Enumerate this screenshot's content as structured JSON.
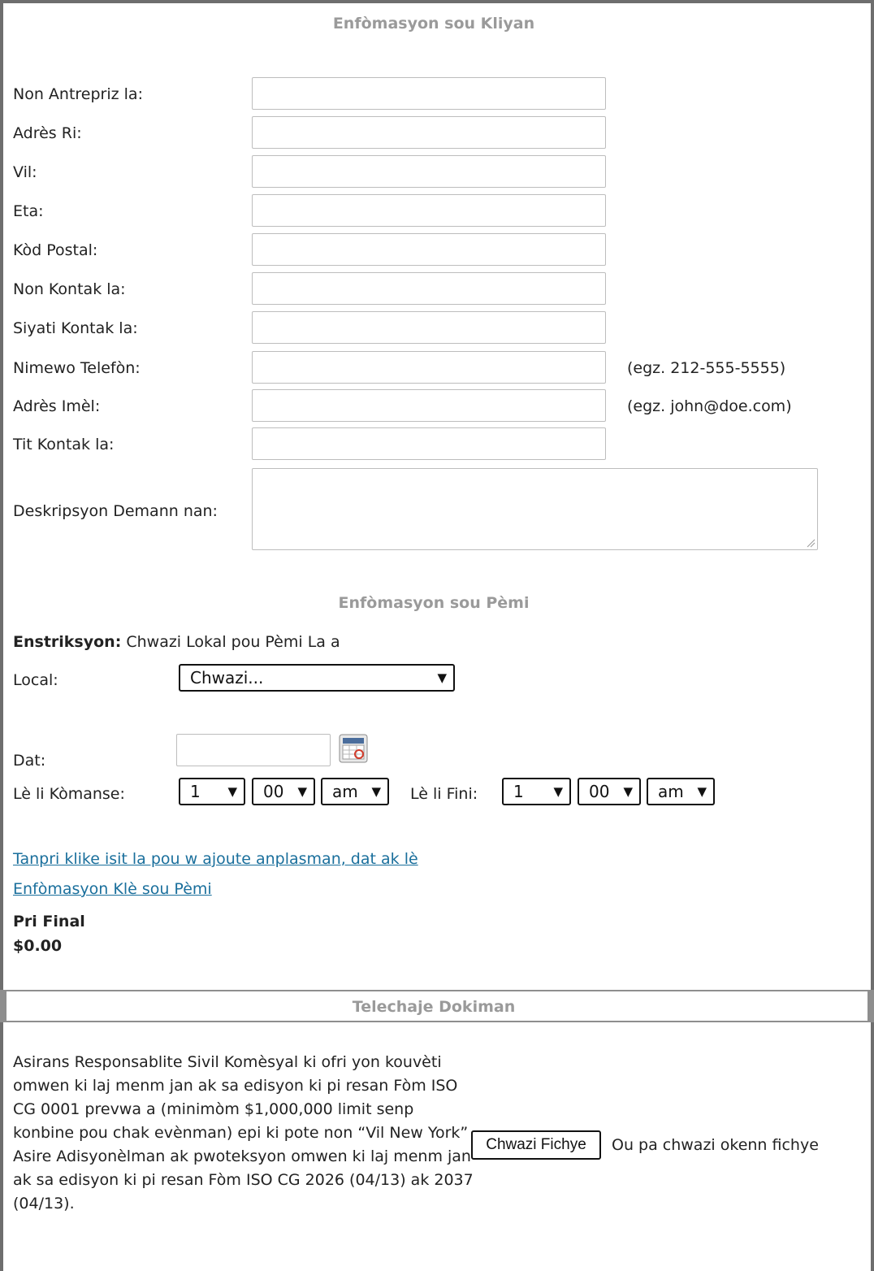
{
  "sections": {
    "client_info": "Enfòmasyon sou Kliyan",
    "permit_info": "Enfòmasyon sou Pèmi",
    "upload_docs": "Telechaje Dokiman"
  },
  "client_fields": {
    "company_name": "Non Antrepriz la:",
    "street_address": "Adrès Ri:",
    "city": "Vil:",
    "state": "Eta:",
    "zip": "Kòd Postal:",
    "contact_name": "Non Kontak la:",
    "contact_surname": "Siyati Kontak la:",
    "phone": "Nimewo Telefòn:",
    "email": "Adrès Imèl:",
    "contact_title": "Tit Kontak la:",
    "description": "Deskripsyon Demann nan:"
  },
  "hints": {
    "phone": "(egz. 212-555-5555)",
    "email": "(egz. john@doe.com)"
  },
  "permit": {
    "instruction_bold": "Enstriksyon:",
    "instruction_text": "Chwazi Lokal pou Pèmi La a",
    "local_label": "Local:",
    "local_value": "Chwazi...",
    "date_label": "Dat:",
    "start_label": "Lè li Kòmanse:",
    "start_hour": "1",
    "start_minute": "00",
    "start_ampm": "am",
    "end_label": "Lè li Fini:",
    "end_hour": "1",
    "end_minute": "00",
    "end_ampm": "am",
    "link_add_locations": "Tanpri klike isit la pou w ajoute anplasman, dat ak lè",
    "link_key_info": "Enfòmasyon Klè sou Pèmi",
    "final_price_label": "Pri Final",
    "final_price_value": "$0.00"
  },
  "upload": {
    "description": "Asirans Responsablite Sivil Komèsyal ki ofri yon kouvèti omwen ki laj menm jan ak sa edisyon ki pi resan Fòm ISO CG 0001 prevwa a (minimòm $1,000,000 limit senp konbine pou chak evènman) epi ki pote non “Vil New York” Asire Adisyonèlman ak pwoteksyon omwen ki laj menm jan ak sa edisyon ki pi resan Fòm ISO CG 2026 (04/13) ak 2037 (04/13).",
    "choose_button": "Chwazi Fichye",
    "no_file": "Ou pa chwazi okenn fichye"
  },
  "icons": {
    "calendar": "calendar-icon",
    "dropdown": "dropdown-arrow-icon"
  },
  "colors": {
    "link": "#1a6f9c",
    "section_title": "#9a9a9a",
    "border": "#6e6e6e"
  }
}
